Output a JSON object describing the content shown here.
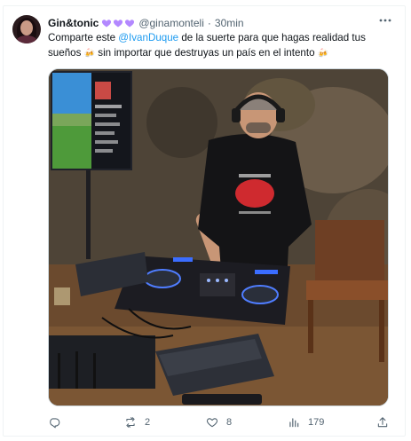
{
  "author": {
    "display_name": "Gin&tonic",
    "handle": "@ginamonteli",
    "separator": "·",
    "time": "30min",
    "heart_color": "#b388ff"
  },
  "tweet": {
    "text_before": "Comparte este ",
    "mention": "@IvanDuque",
    "text_middle": " de la suerte para que hagas realidad tus sueños ",
    "emoji": "🍻",
    "text_after": " sin importar que destruyas un país en el intento ",
    "emoji_end": "🍻"
  },
  "media": {
    "image_desc_icon": "photo-dj-icon"
  },
  "actions": {
    "reply_count": "",
    "retweet_count": "2",
    "like_count": "8",
    "views_count": "179",
    "accent": "#1d9bf0",
    "muted": "#536471"
  }
}
